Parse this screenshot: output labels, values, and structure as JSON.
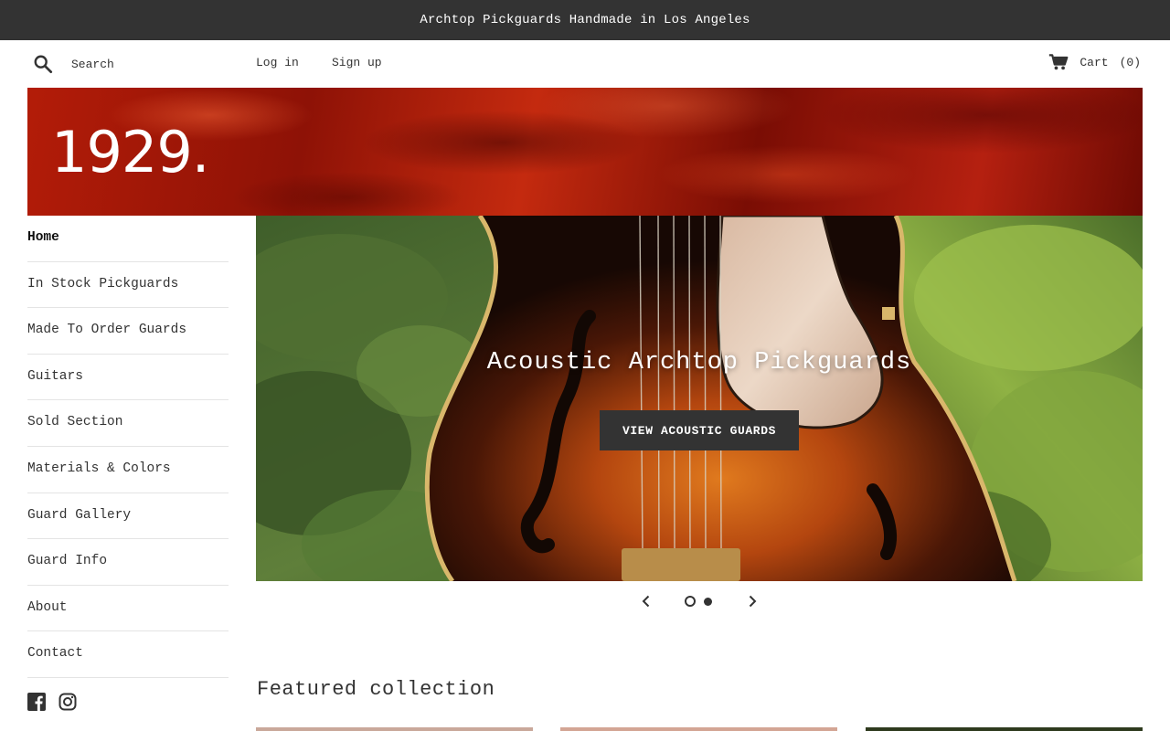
{
  "announcement": "Archtop Pickguards Handmade in Los Angeles",
  "header": {
    "search_placeholder": "Search",
    "login_label": "Log in",
    "signup_label": "Sign up",
    "cart_label": "Cart",
    "cart_count": "(0)"
  },
  "banner": {
    "logo_text": "1929."
  },
  "sidebar": {
    "items": [
      {
        "label": "Home"
      },
      {
        "label": "In Stock Pickguards"
      },
      {
        "label": "Made To Order Guards"
      },
      {
        "label": "Guitars"
      },
      {
        "label": "Sold Section"
      },
      {
        "label": "Materials & Colors"
      },
      {
        "label": "Guard Gallery"
      },
      {
        "label": "Guard Info"
      },
      {
        "label": "About"
      },
      {
        "label": "Contact"
      }
    ],
    "social_icons": [
      "facebook-icon",
      "instagram-icon"
    ]
  },
  "slideshow": {
    "heading": "Acoustic Archtop Pickguards",
    "button_label": "VIEW ACOUSTIC GUARDS",
    "slide_count": 2,
    "current_slide": 1
  },
  "featured": {
    "title": "Featured collection"
  },
  "colors": {
    "announcement_bg": "#333333",
    "button_bg": "#333333",
    "banner_red": "#b31c08",
    "text": "#333333"
  }
}
